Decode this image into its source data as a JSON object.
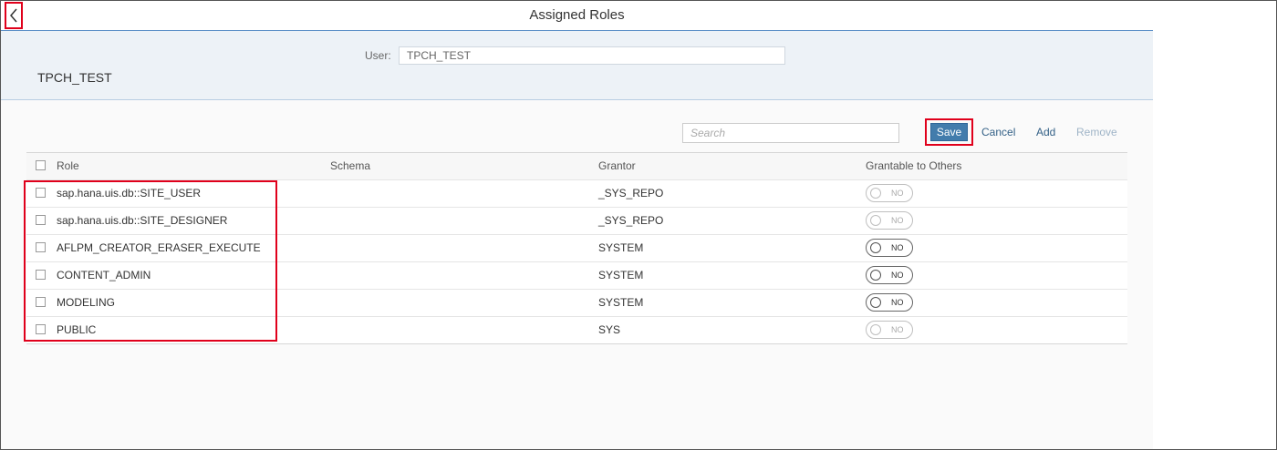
{
  "title": "Assigned Roles",
  "header": {
    "user_name": "TPCH_TEST",
    "user_label": "User:",
    "user_value": "TPCH_TEST"
  },
  "toolbar": {
    "search_placeholder": "Search",
    "save_label": "Save",
    "cancel_label": "Cancel",
    "add_label": "Add",
    "remove_label": "Remove"
  },
  "table": {
    "columns": [
      "Role",
      "Schema",
      "Grantor",
      "Grantable to Others"
    ],
    "rows": [
      {
        "role": "sap.hana.uis.db::SITE_USER",
        "schema": "",
        "grantor": "_SYS_REPO",
        "grantable": "NO",
        "enabled": false
      },
      {
        "role": "sap.hana.uis.db::SITE_DESIGNER",
        "schema": "",
        "grantor": "_SYS_REPO",
        "grantable": "NO",
        "enabled": false
      },
      {
        "role": "AFLPM_CREATOR_ERASER_EXECUTE",
        "schema": "",
        "grantor": "SYSTEM",
        "grantable": "NO",
        "enabled": true
      },
      {
        "role": "CONTENT_ADMIN",
        "schema": "",
        "grantor": "SYSTEM",
        "grantable": "NO",
        "enabled": true
      },
      {
        "role": "MODELING",
        "schema": "",
        "grantor": "SYSTEM",
        "grantable": "NO",
        "enabled": true
      },
      {
        "role": "PUBLIC",
        "schema": "",
        "grantor": "SYS",
        "grantable": "NO",
        "enabled": false
      }
    ]
  },
  "colors": {
    "accent": "#427cac",
    "highlight": "#e0001b",
    "link": "#346187"
  },
  "icons": {
    "back": "chevron-left-icon"
  }
}
